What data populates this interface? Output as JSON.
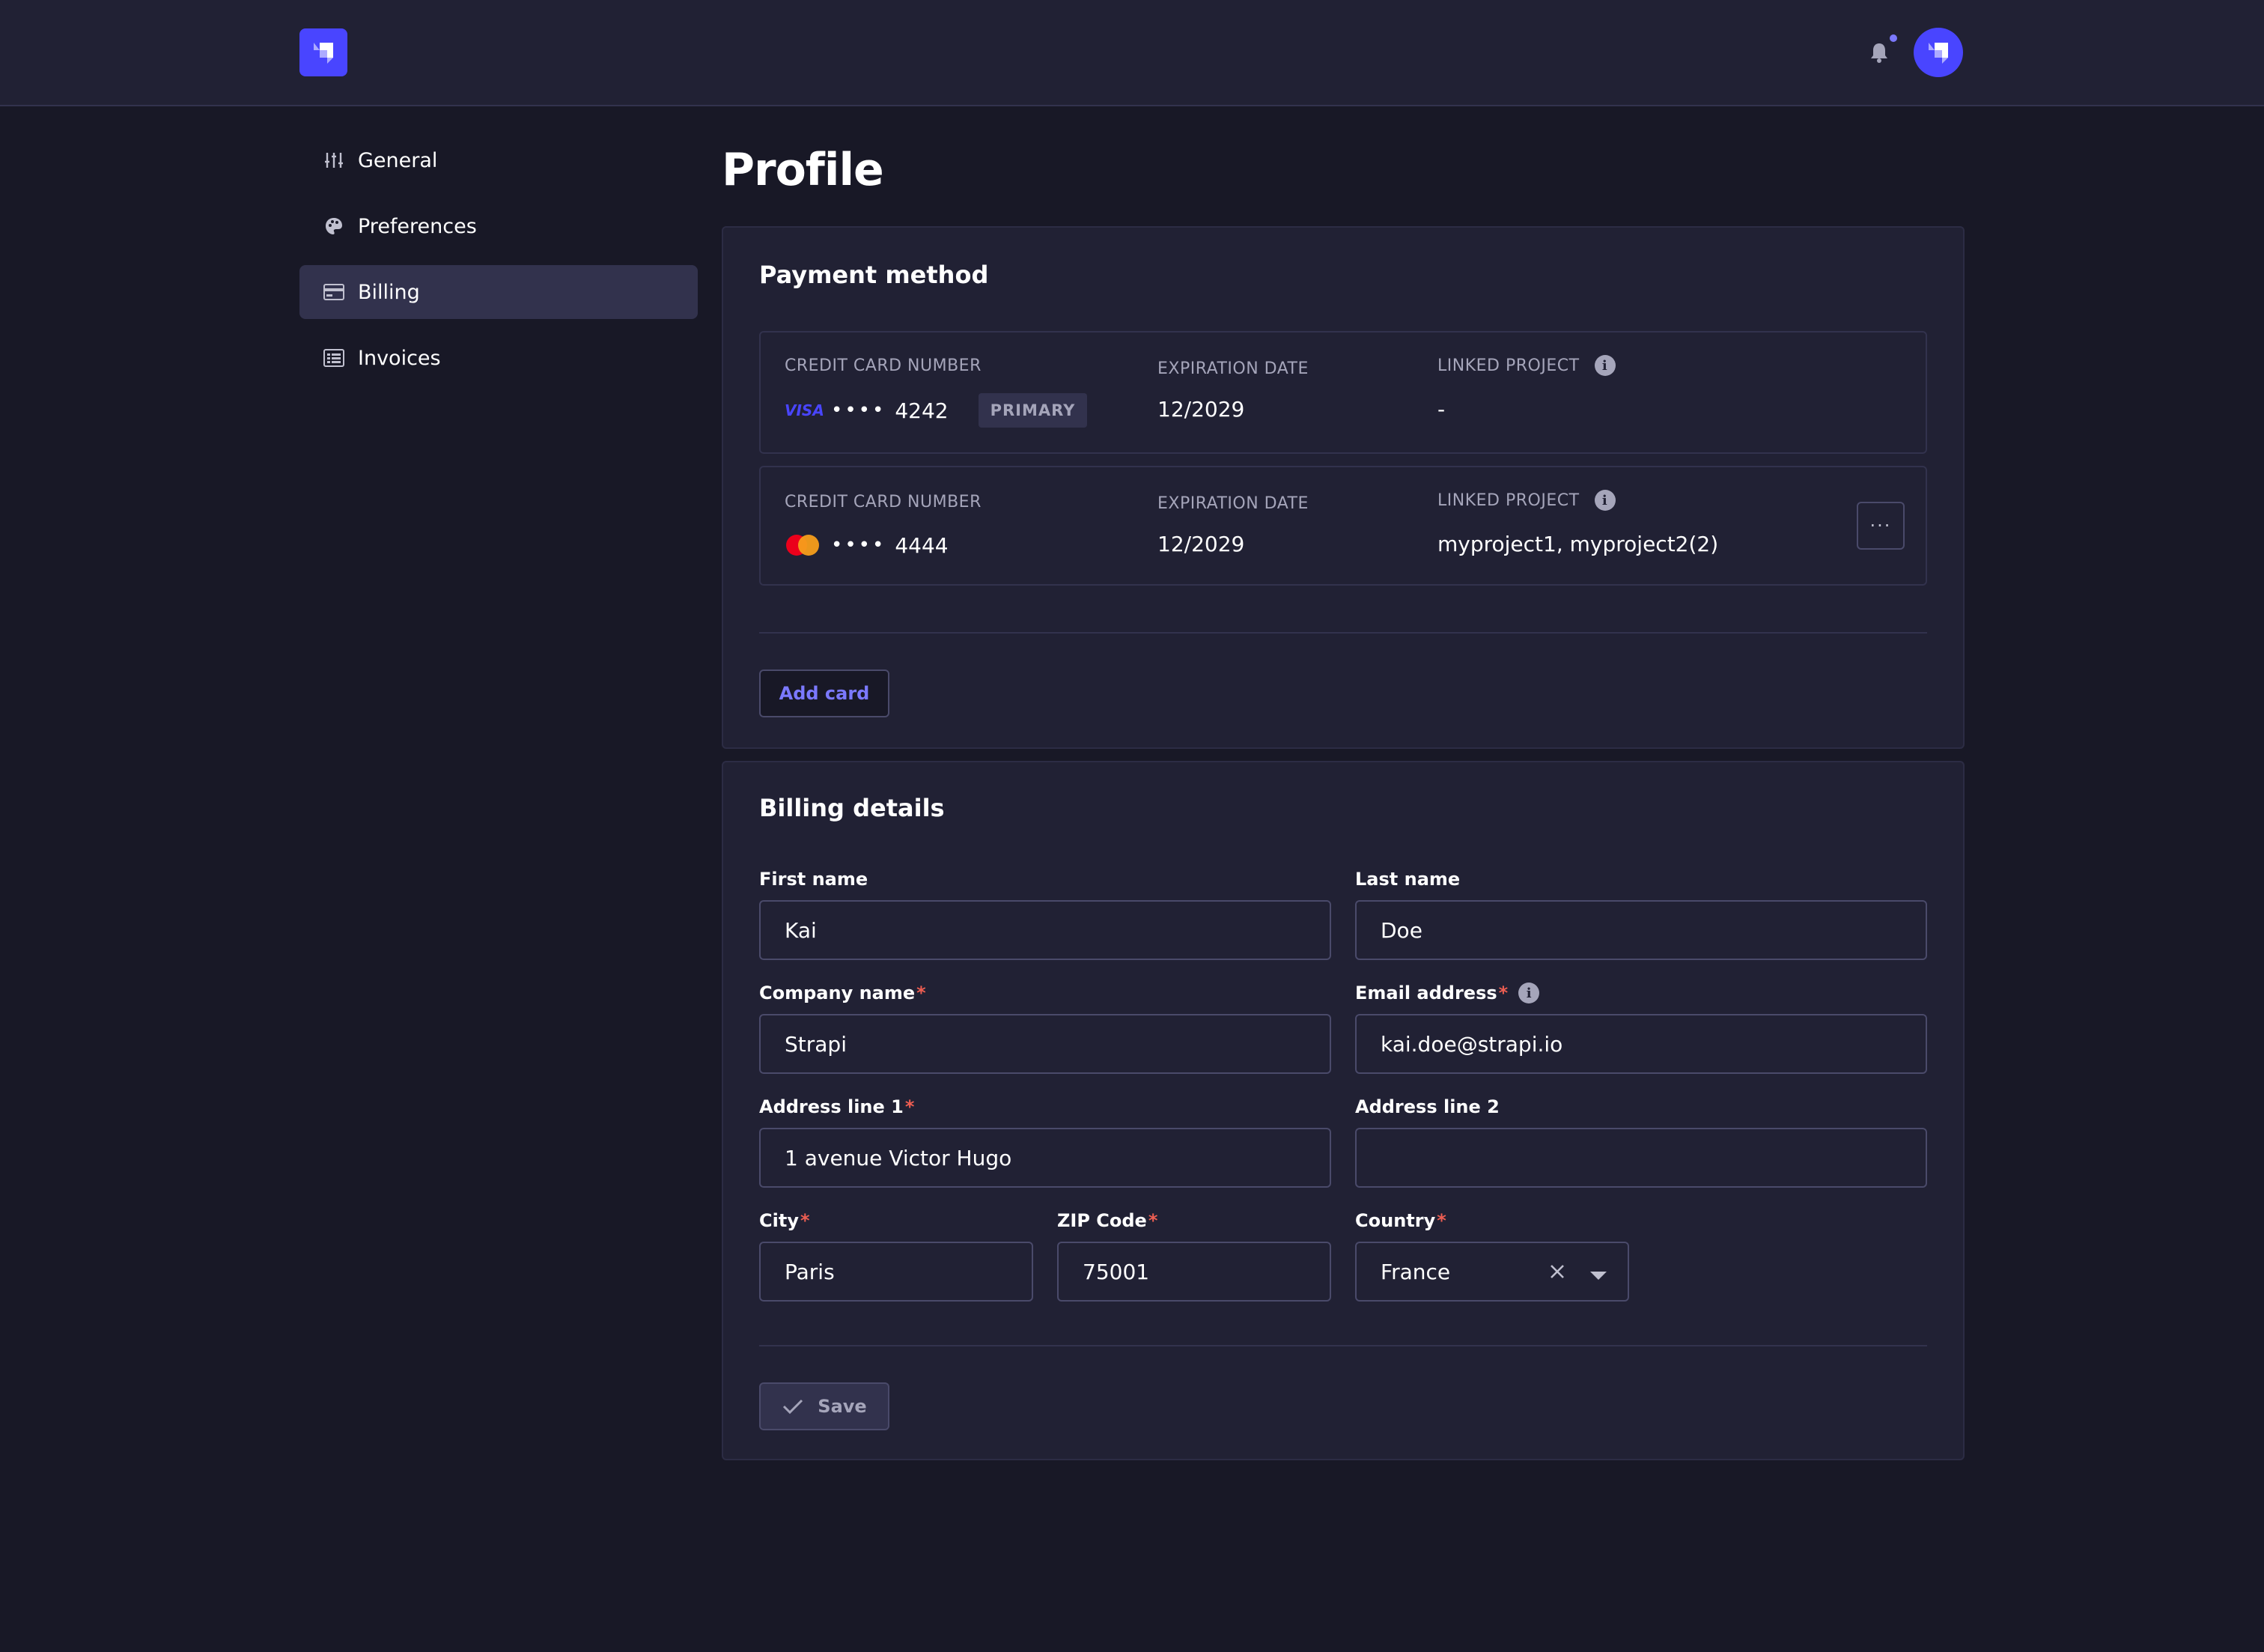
{
  "header": {
    "logo_icon": "strapi-logo-icon",
    "notification_icon": "bell-icon",
    "avatar_icon": "strapi-logo-icon"
  },
  "sidebar": {
    "items": [
      {
        "label": "General",
        "icon": "sliders-icon",
        "active": false
      },
      {
        "label": "Preferences",
        "icon": "palette-icon",
        "active": false
      },
      {
        "label": "Billing",
        "icon": "credit-card-icon",
        "active": true
      },
      {
        "label": "Invoices",
        "icon": "invoice-icon",
        "active": false
      }
    ]
  },
  "page": {
    "title": "Profile"
  },
  "payment": {
    "title": "Payment method",
    "cards": [
      {
        "number_label": "CREDIT CARD NUMBER",
        "brand": "VISA",
        "masked": "••••",
        "last4": "4242",
        "badge": "PRIMARY",
        "exp_label": "EXPIRATION DATE",
        "exp": "12/2029",
        "linked_label": "LINKED PROJECT",
        "linked": "-"
      },
      {
        "number_label": "CREDIT CARD NUMBER",
        "brand": "mastercard",
        "masked": "••••",
        "last4": "4444",
        "exp_label": "EXPIRATION DATE",
        "exp": "12/2029",
        "linked_label": "LINKED PROJECT",
        "linked": "myproject1, myproject2(2)",
        "more_label": "···"
      }
    ],
    "add_card_label": "Add card"
  },
  "billing": {
    "title": "Billing details",
    "first_name": {
      "label": "First name",
      "value": "Kai"
    },
    "last_name": {
      "label": "Last name",
      "value": "Doe"
    },
    "company": {
      "label": "Company name",
      "value": "Strapi",
      "required": "*"
    },
    "email": {
      "label": "Email address",
      "value": "kai.doe@strapi.io",
      "required": "*"
    },
    "address1": {
      "label": "Address line 1",
      "value": "1 avenue Victor Hugo",
      "required": "*"
    },
    "address2": {
      "label": "Address line 2",
      "value": ""
    },
    "city": {
      "label": "City",
      "value": "Paris",
      "required": "*"
    },
    "zip": {
      "label": "ZIP Code",
      "value": "75001",
      "required": "*"
    },
    "country": {
      "label": "Country",
      "value": "France",
      "required": "*"
    },
    "save_label": "Save"
  },
  "colors": {
    "background": "#181826",
    "surface": "#212134",
    "accent": "#4945ff",
    "accent_text": "#7b79ff",
    "required": "#ee5e52"
  }
}
